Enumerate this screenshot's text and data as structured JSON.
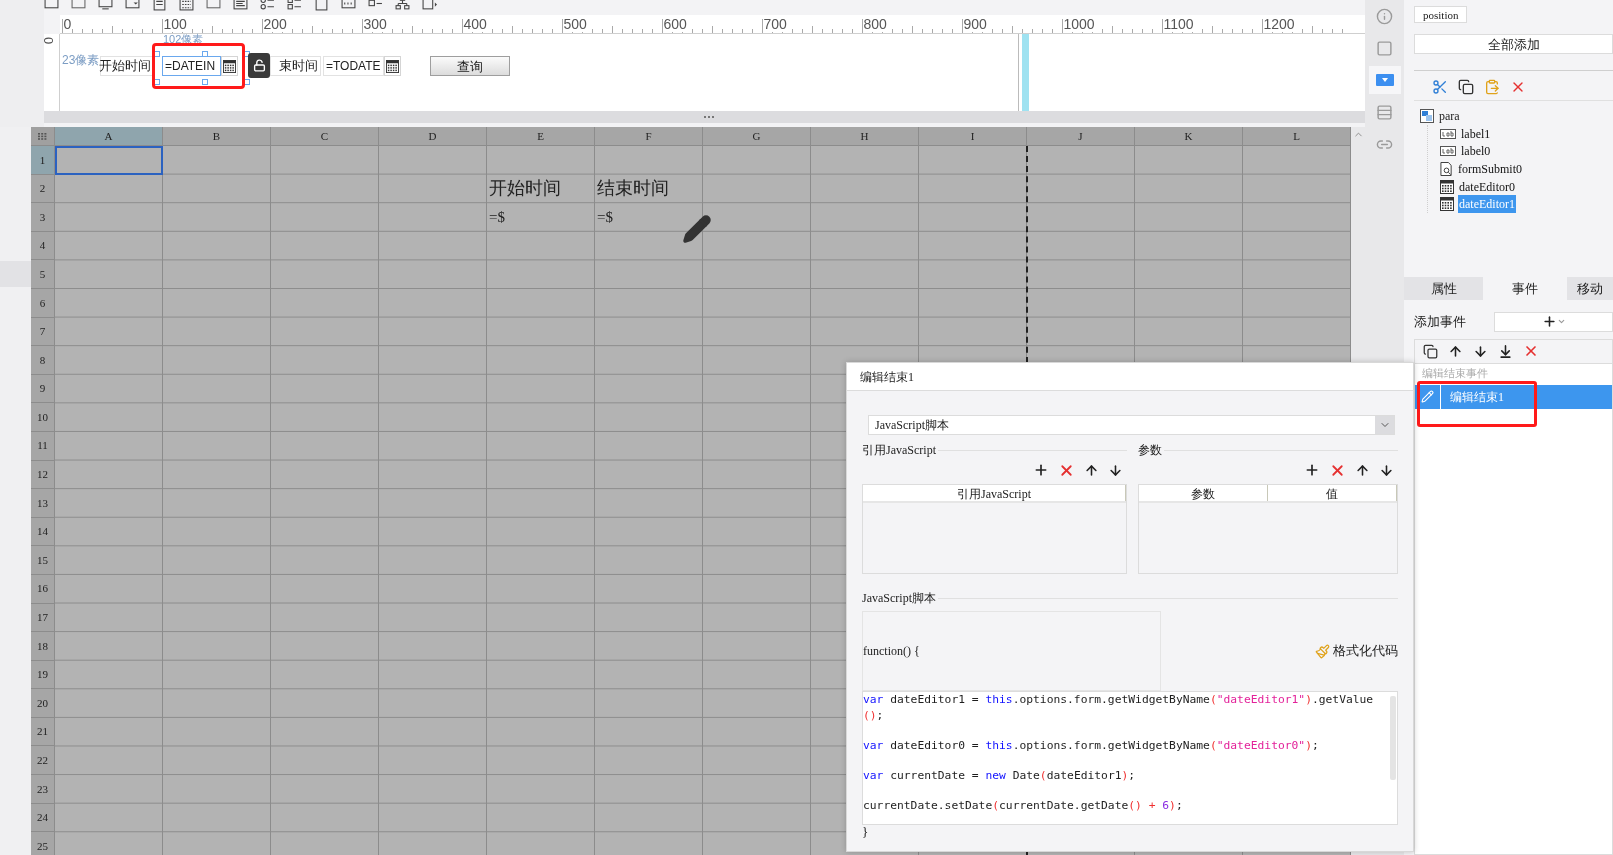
{
  "ruler": {
    "marks": [
      "0",
      "100",
      "200",
      "300",
      "400",
      "500",
      "600",
      "700",
      "800",
      "900",
      "1000",
      "1100",
      "1200"
    ]
  },
  "vertical_ruler": {
    "marks": [
      "0"
    ]
  },
  "form_canvas": {
    "width_hint": "102像素",
    "height_hint": "23像素",
    "widgets": [
      {
        "kind": "label",
        "text": "开始时间"
      },
      {
        "kind": "date",
        "value": "=DATEIN",
        "selected": true
      },
      {
        "kind": "label",
        "text": "束时间"
      },
      {
        "kind": "date",
        "value": "=TODATE",
        "selected": false
      },
      {
        "kind": "button",
        "text": "查询"
      }
    ]
  },
  "sheet": {
    "columns": [
      {
        "label": "A",
        "selected": true
      },
      {
        "label": "B",
        "selected": false
      },
      {
        "label": "C",
        "selected": false
      },
      {
        "label": "D",
        "selected": false
      },
      {
        "label": "E",
        "selected": false
      },
      {
        "label": "F",
        "selected": false
      },
      {
        "label": "G",
        "selected": false
      },
      {
        "label": "H",
        "selected": false
      },
      {
        "label": "I",
        "selected": false
      },
      {
        "label": "J",
        "selected": false
      },
      {
        "label": "K",
        "selected": false
      },
      {
        "label": "L",
        "selected": false
      }
    ],
    "rows": [
      {
        "label": "1",
        "selected": true
      },
      {
        "label": "2",
        "selected": false,
        "cells": [
          null,
          null,
          null,
          null,
          "开始时间",
          "结束时间"
        ]
      },
      {
        "label": "3",
        "selected": false,
        "cells": [
          null,
          null,
          null,
          null,
          "=$",
          "=$"
        ]
      },
      {
        "label": "4",
        "selected": false
      },
      {
        "label": "5",
        "selected": false
      },
      {
        "label": "6",
        "selected": false
      },
      {
        "label": "7",
        "selected": false
      },
      {
        "label": "8",
        "selected": false
      },
      {
        "label": "9",
        "selected": false
      },
      {
        "label": "10",
        "selected": false
      },
      {
        "label": "11",
        "selected": false
      },
      {
        "label": "12",
        "selected": false
      },
      {
        "label": "13",
        "selected": false
      },
      {
        "label": "14",
        "selected": false
      },
      {
        "label": "15",
        "selected": false
      },
      {
        "label": "16",
        "selected": false
      },
      {
        "label": "17",
        "selected": false
      },
      {
        "label": "18",
        "selected": false
      },
      {
        "label": "19",
        "selected": false
      },
      {
        "label": "20",
        "selected": false
      },
      {
        "label": "21",
        "selected": false
      },
      {
        "label": "22",
        "selected": false
      },
      {
        "label": "23",
        "selected": false
      },
      {
        "label": "24",
        "selected": false
      },
      {
        "label": "25",
        "selected": false
      }
    ]
  },
  "side_tools": [
    {
      "kind": "info",
      "selected": false
    },
    {
      "kind": "frame",
      "selected": false
    },
    {
      "kind": "widget",
      "selected": true
    },
    {
      "kind": "layout",
      "selected": false
    },
    {
      "kind": "link",
      "selected": false
    }
  ],
  "right_panel": {
    "position_tab": "position",
    "add_all_button": "全部添加",
    "tree": {
      "label": "para",
      "kind": "form",
      "children": [
        {
          "label": "label1",
          "kind": "label",
          "selected": false
        },
        {
          "label": "label0",
          "kind": "label",
          "selected": false
        },
        {
          "label": "formSubmit0",
          "kind": "submit",
          "selected": false
        },
        {
          "label": "dateEditor0",
          "kind": "date",
          "selected": false
        },
        {
          "label": "dateEditor1",
          "kind": "date",
          "selected": true
        }
      ]
    },
    "tabs": [
      {
        "label": "属性",
        "selected": false
      },
      {
        "label": "事件",
        "selected": true
      },
      {
        "label": "移动",
        "selected": false
      }
    ],
    "add_event_label": "添加事件",
    "event_group": "编辑结束事件",
    "events": [
      {
        "label": "编辑结束1",
        "selected": true
      }
    ]
  },
  "dialog": {
    "title": "编辑结束1",
    "type_select": {
      "value": "JavaScript脚本"
    },
    "ref_section": {
      "title": "引用JavaScript",
      "columns": [
        "引用JavaScript"
      ]
    },
    "params_section": {
      "title": "参数",
      "columns": [
        "参数",
        "值"
      ]
    },
    "script_section": {
      "title": "JavaScript脚本",
      "signature": "function() {",
      "format_button": "格式化代码",
      "closing": "}",
      "statements": [
        {
          "lines": [
            [
              {
                "kind": "keyword",
                "text": "var"
              },
              {
                "kind": "plain",
                "text": " dateEditor1 = "
              },
              {
                "kind": "keyword",
                "text": "this"
              },
              {
                "kind": "plain",
                "text": ".options.form.getWidgetByName"
              },
              {
                "kind": "paren",
                "text": "("
              },
              {
                "kind": "string",
                "text": "\"dateEditor1\""
              },
              {
                "kind": "paren",
                "text": ")"
              },
              {
                "kind": "plain",
                "text": ".getValue"
              }
            ],
            [
              {
                "kind": "paren",
                "text": "()"
              },
              {
                "kind": "plain",
                "text": ";"
              }
            ]
          ]
        },
        {
          "lines": [
            [
              {
                "kind": "keyword",
                "text": "var"
              },
              {
                "kind": "plain",
                "text": " dateEditor0 = "
              },
              {
                "kind": "keyword",
                "text": "this"
              },
              {
                "kind": "plain",
                "text": ".options.form.getWidgetByName"
              },
              {
                "kind": "paren",
                "text": "("
              },
              {
                "kind": "string",
                "text": "\"dateEditor0\""
              },
              {
                "kind": "paren",
                "text": ")"
              },
              {
                "kind": "plain",
                "text": ";"
              }
            ]
          ]
        },
        {
          "lines": [
            [
              {
                "kind": "keyword",
                "text": "var"
              },
              {
                "kind": "plain",
                "text": " currentDate = "
              },
              {
                "kind": "keyword",
                "text": "new"
              },
              {
                "kind": "plain",
                "text": " Date"
              },
              {
                "kind": "paren",
                "text": "("
              },
              {
                "kind": "plain",
                "text": "dateEditor1"
              },
              {
                "kind": "paren",
                "text": ")"
              },
              {
                "kind": "plain",
                "text": ";"
              }
            ]
          ]
        },
        {
          "lines": [
            [
              {
                "kind": "plain",
                "text": "currentDate.setDate"
              },
              {
                "kind": "paren",
                "text": "("
              },
              {
                "kind": "plain",
                "text": "currentDate.getDate"
              },
              {
                "kind": "paren",
                "text": "()"
              },
              {
                "kind": "paren",
                "text": " + "
              },
              {
                "kind": "number",
                "text": "6"
              },
              {
                "kind": "paren",
                "text": ")"
              },
              {
                "kind": "plain",
                "text": ";"
              }
            ]
          ]
        }
      ]
    }
  }
}
